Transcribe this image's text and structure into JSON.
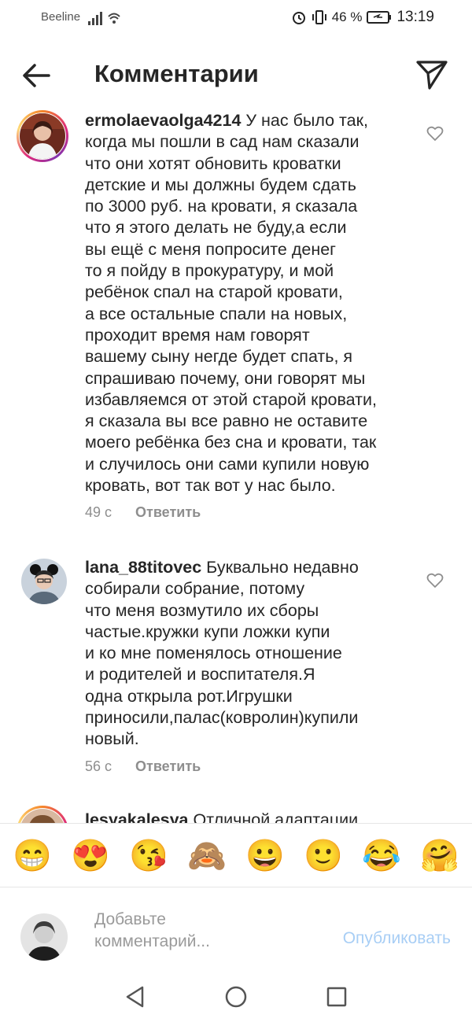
{
  "status_bar": {
    "carrier": "Beeline",
    "battery": "46 %",
    "time": "13:19"
  },
  "header": {
    "title": "Комментарии"
  },
  "comments": [
    {
      "username": "ermolaevaolga4214",
      "text": " У нас было так,\nкогда мы пошли в сад нам сказали\nчто они хотят обновить кроватки\nдетские и мы должны будем сдать\nпо 3000 руб. на кровати, я сказала\nчто я этого делать не буду,а если\nвы ещё с меня попросите денег\nто я пойду в прокуратуру, и мой\nребёнок спал на старой кровати,\nа все остальные спали на новых,\nпроходит время нам говорят\nвашему сыну негде будет спать, я\nспрашиваю почему, они говорят мы\nизбавляемся от этой старой кровати,\nя сказала вы все равно не оставите\nмоего ребёнка без сна и кровати, так\nи случилось они сами купили новую\nкровать, вот так вот у нас было.",
      "time": "49 с",
      "reply": "Ответить"
    },
    {
      "username": "lana_88titovec",
      "text": " Буквально недавно\nсобирали собрание, потому\nчто меня возмутило их сборы\nчастые.кружки купи ложки купи\nи ко мне поменялось отношение\nи родителей и воспитателя.Я\nодна открыла рот.Игрушки\nприносили,палас(ковролин)купили\nновый.",
      "time": "56 с",
      "reply": "Ответить"
    },
    {
      "username": "lesyakalesya",
      "text": " Отличной адаптации"
    }
  ],
  "emojis": [
    "😁",
    "😍",
    "😘",
    "🙈",
    "😀",
    "🙂",
    "😂",
    "🤗"
  ],
  "composer": {
    "placeholder": "Добавьте\nкомментарий...",
    "post_label": "Опубликовать"
  },
  "icons": {
    "back": "arrow-left-icon",
    "send": "paper-plane-icon",
    "like": "heart-outline-icon",
    "nav_back": "triangle-back-icon",
    "nav_home": "circle-home-icon",
    "nav_recents": "square-recents-icon"
  }
}
